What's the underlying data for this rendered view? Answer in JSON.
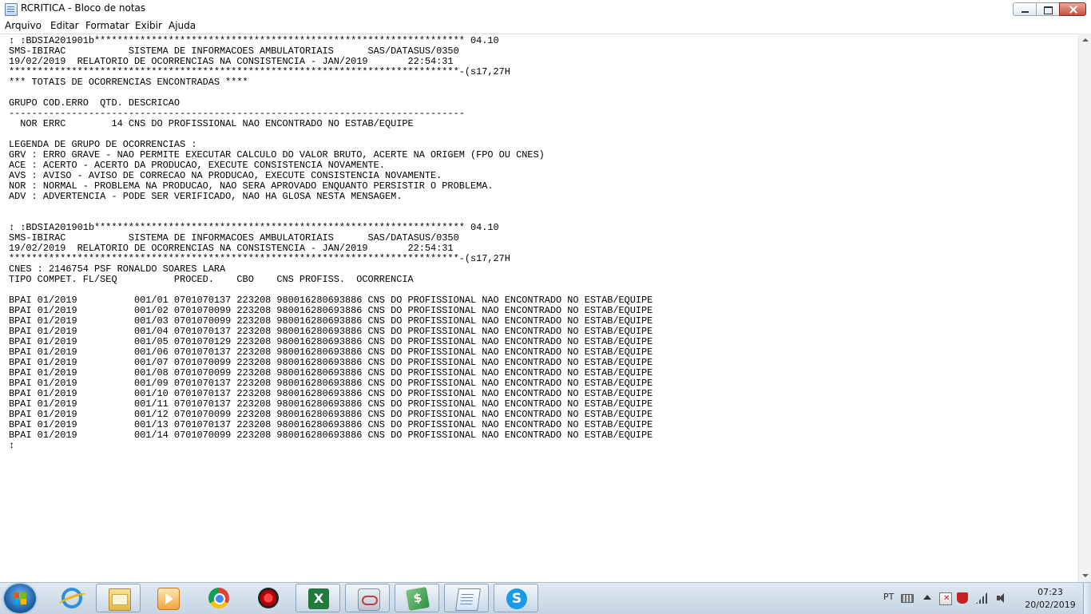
{
  "window": {
    "title": "RCRITICA - Bloco de notas"
  },
  "menu": {
    "arquivo": "Arquivo",
    "editar": "Editar",
    "formatar": "Formatar",
    "exibir": "Exibir",
    "ajuda": "Ajuda"
  },
  "editor": {
    "content": "↕ ↕BDSIA201901b***************************************************************** 04.10\nSMS-IBIRAC           SISTEMA DE INFORMACOES AMBULATORIAIS      SAS/DATASUS/0350\n19/02/2019  RELATORIO DE OCORRENCIAS NA CONSISTENCIA - JAN/2019       22:54:31\n*******************************************************************************-(s17,27H\n*** TOTAIS DE OCORRENCIAS ENCONTRADAS ****\n\nGRUPO COD.ERRO  QTD. DESCRICAO\n--------------------------------------------------------------------------------\n  NOR ERRC        14 CNS DO PROFISSIONAL NAO ENCONTRADO NO ESTAB/EQUIPE\n\nLEGENDA DE GRUPO DE OCORRENCIAS :\nGRV : ERRO GRAVE - NAO PERMITE EXECUTAR CALCULO DO VALOR BRUTO, ACERTE NA ORIGEM (FPO OU CNES)\nACE : ACERTO - ACERTO DA PRODUCAO, EXECUTE CONSISTENCIA NOVAMENTE.\nAVS : AVISO - AVISO DE CORRECAO NA PRODUCAO, EXECUTE CONSISTENCIA NOVAMENTE.\nNOR : NORMAL - PROBLEMA NA PRODUCAO, NAO SERA APROVADO ENQUANTO PERSISTIR O PROBLEMA.\nADV : ADVERTENCIA - PODE SER VERIFICADO, NAO HA GLOSA NESTA MENSAGEM.\n\n\n↕ ↕BDSIA201901b***************************************************************** 04.10\nSMS-IBIRAC           SISTEMA DE INFORMACOES AMBULATORIAIS      SAS/DATASUS/0350\n19/02/2019  RELATORIO DE OCORRENCIAS NA CONSISTENCIA - JAN/2019       22:54:31\n*******************************************************************************-(s17,27H\nCNES : 2146754 PSF RONALDO SOARES LARA\nTIPO COMPET. FL/SEQ          PROCED.    CBO    CNS PROFISS.  OCORRENCIA\n\nBPAI 01/2019          001/01 0701070137 223208 980016280693886 CNS DO PROFISSIONAL NAO ENCONTRADO NO ESTAB/EQUIPE\nBPAI 01/2019          001/02 0701070099 223208 980016280693886 CNS DO PROFISSIONAL NAO ENCONTRADO NO ESTAB/EQUIPE\nBPAI 01/2019          001/03 0701070099 223208 980016280693886 CNS DO PROFISSIONAL NAO ENCONTRADO NO ESTAB/EQUIPE\nBPAI 01/2019          001/04 0701070137 223208 980016280693886 CNS DO PROFISSIONAL NAO ENCONTRADO NO ESTAB/EQUIPE\nBPAI 01/2019          001/05 0701070129 223208 980016280693886 CNS DO PROFISSIONAL NAO ENCONTRADO NO ESTAB/EQUIPE\nBPAI 01/2019          001/06 0701070137 223208 980016280693886 CNS DO PROFISSIONAL NAO ENCONTRADO NO ESTAB/EQUIPE\nBPAI 01/2019          001/07 0701070099 223208 980016280693886 CNS DO PROFISSIONAL NAO ENCONTRADO NO ESTAB/EQUIPE\nBPAI 01/2019          001/08 0701070099 223208 980016280693886 CNS DO PROFISSIONAL NAO ENCONTRADO NO ESTAB/EQUIPE\nBPAI 01/2019          001/09 0701070137 223208 980016280693886 CNS DO PROFISSIONAL NAO ENCONTRADO NO ESTAB/EQUIPE\nBPAI 01/2019          001/10 0701070137 223208 980016280693886 CNS DO PROFISSIONAL NAO ENCONTRADO NO ESTAB/EQUIPE\nBPAI 01/2019          001/11 0701070137 223208 980016280693886 CNS DO PROFISSIONAL NAO ENCONTRADO NO ESTAB/EQUIPE\nBPAI 01/2019          001/12 0701070099 223208 980016280693886 CNS DO PROFISSIONAL NAO ENCONTRADO NO ESTAB/EQUIPE\nBPAI 01/2019          001/13 0701070137 223208 980016280693886 CNS DO PROFISSIONAL NAO ENCONTRADO NO ESTAB/EQUIPE\nBPAI 01/2019          001/14 0701070099 223208 980016280693886 CNS DO PROFISSIONAL NAO ENCONTRADO NO ESTAB/EQUIPE\n↕"
  },
  "taskbar": {
    "icons": [
      "start-button",
      "ie-icon",
      "file-explorer-icon",
      "media-player-icon",
      "chrome-icon",
      "red-app-icon",
      "excel-icon",
      "network-app-icon",
      "money-app-icon",
      "notepad-icon",
      "skype-icon"
    ],
    "language": "PT",
    "time": "07:23",
    "date": "20/02/2019"
  }
}
